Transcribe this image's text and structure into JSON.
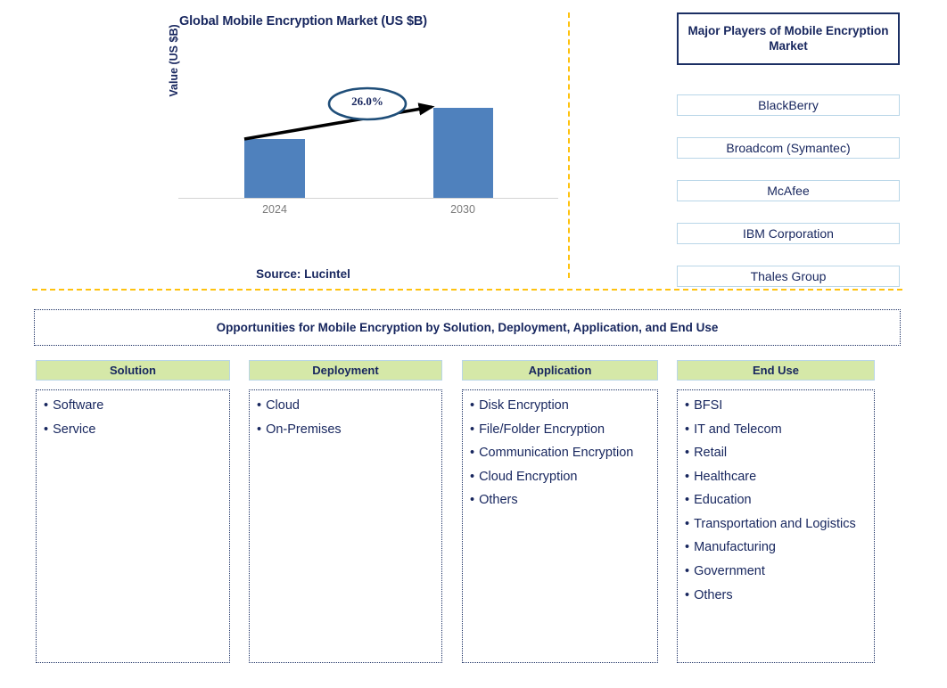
{
  "chart_panel": {
    "title": "Global Mobile Encryption Market (US $B)",
    "source": "Source: Lucintel"
  },
  "chart_data": {
    "type": "bar",
    "title": "Global Mobile Encryption Market (US $B)",
    "categories": [
      "2024",
      "2030"
    ],
    "values": [
      66,
      101
    ],
    "xlabel": "",
    "ylabel": "Value (US $B)",
    "tick_labels": [
      "2024",
      "2030"
    ],
    "grid": false,
    "legend": "none",
    "annotations": [
      {
        "label": "26.0%",
        "type": "cagr-callout",
        "from": "2024",
        "to": "2030",
        "shape": "ellipse-with-arrow"
      }
    ],
    "bar_color": "#4f81bd",
    "axis_color": "#d4d4d4",
    "tick_label_color": "#7a7a7a",
    "text_color": "#17265e"
  },
  "players_panel": {
    "header": "Major Players of Mobile Encryption Market",
    "items": [
      "BlackBerry",
      "Broadcom (Symantec)",
      "McAfee",
      "IBM Corporation",
      "Thales Group"
    ]
  },
  "opportunities": {
    "banner": "Opportunities for Mobile Encryption by Solution, Deployment, Application, and End Use",
    "columns": [
      {
        "header": "Solution",
        "items": [
          "Software",
          "Service"
        ]
      },
      {
        "header": "Deployment",
        "items": [
          "Cloud",
          "On-Premises"
        ]
      },
      {
        "header": "Application",
        "items": [
          "Disk Encryption",
          "File/Folder Encryption",
          "Communication Encryption",
          "Cloud Encryption",
          "Others"
        ]
      },
      {
        "header": "End Use",
        "items": [
          "BFSI",
          "IT and Telecom",
          "Retail",
          "Healthcare",
          "Education",
          "Transportation and Logistics",
          "Manufacturing",
          "Government",
          "Others"
        ]
      }
    ]
  },
  "colors": {
    "bar": "#4f81bd",
    "navy_text": "#17265e",
    "divider_amber": "#ffc20e",
    "header_green": "#d5e8a8",
    "box_border_blue": "#b9d6e8"
  }
}
